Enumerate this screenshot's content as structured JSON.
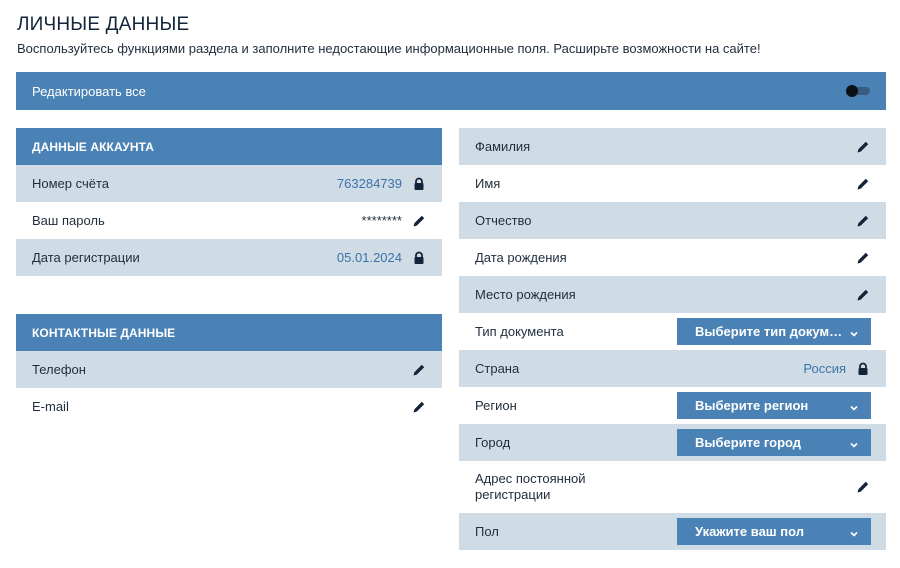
{
  "header": {
    "title": "ЛИЧНЫЕ ДАННЫЕ",
    "subtitle": "Воспользуйтесь функциями раздела и заполните недостающие информационные поля. Расширьте возможности на сайте!"
  },
  "edit_all": {
    "label": "Редактировать все",
    "toggle_on": false
  },
  "account": {
    "header": "ДАННЫЕ АККАУНТА",
    "rows": [
      {
        "label": "Номер счёта",
        "value": "763284739",
        "icon": "lock-icon"
      },
      {
        "label": "Ваш пароль",
        "value": "********",
        "icon": "pencil-icon"
      },
      {
        "label": "Дата регистрации",
        "value": "05.01.2024",
        "icon": "lock-icon"
      }
    ]
  },
  "contacts": {
    "header": "КОНТАКТНЫЕ ДАННЫЕ",
    "rows": [
      {
        "label": "Телефон",
        "icon": "pencil-icon"
      },
      {
        "label": "E-mail",
        "icon": "pencil-icon"
      }
    ]
  },
  "personal": {
    "rows": [
      {
        "label": "Фамилия",
        "icon": "pencil-icon"
      },
      {
        "label": "Имя",
        "icon": "pencil-icon"
      },
      {
        "label": "Отчество",
        "icon": "pencil-icon"
      },
      {
        "label": "Дата рождения",
        "icon": "pencil-icon"
      },
      {
        "label": "Место рождения",
        "icon": "pencil-icon"
      },
      {
        "label": "Тип документа",
        "select": "Выберите тип документа"
      },
      {
        "label": "Страна",
        "value": "Россия",
        "icon": "lock-icon"
      },
      {
        "label": "Регион",
        "select": "Выберите регион"
      },
      {
        "label": "Город",
        "select": "Выберите город"
      },
      {
        "label": "Адрес постоянной регистрации",
        "icon": "pencil-icon"
      },
      {
        "label": "Пол",
        "select": "Укажите ваш пол"
      }
    ]
  },
  "colors": {
    "accent": "#4a82b5",
    "row_shaded": "#d0dce5",
    "value_blue": "#3b73a8"
  }
}
